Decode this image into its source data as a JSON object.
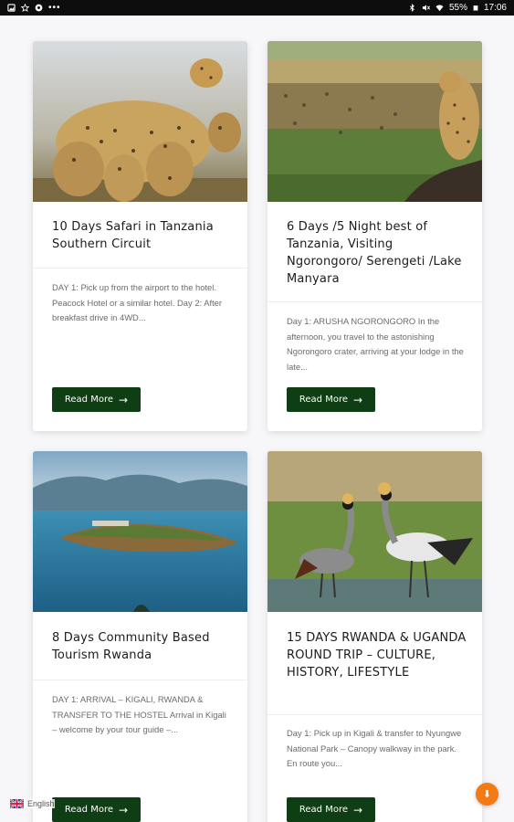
{
  "status_bar": {
    "battery": "55%",
    "time": "17:06",
    "left_icons": [
      "image-icon",
      "star-icon",
      "settings-icon",
      "more-dots-icon"
    ],
    "right_icons": [
      "bluetooth-icon",
      "mute-icon",
      "wifi-icon",
      "battery-icon"
    ]
  },
  "tours": [
    {
      "title": "10 Days Safari in Tanzania Southern Circuit",
      "description": "DAY 1: Pick up from the airport to the hotel. Peacock Hotel or a similar hotel. Day 2: After breakfast drive in 4WD...",
      "cta": "Read More",
      "image": "cheetah family photo"
    },
    {
      "title": "6 Days /5 Night best of Tanzania, Visiting Ngorongoro/ Serengeti /Lake Manyara",
      "description": "Day 1: ARUSHA NGORONGORO In the afternoon, you travel to the astonishing Ngorongoro crater, arriving at your lodge in the late...",
      "cta": "Read More",
      "image": "cheetah on rock overlooking savanna photo"
    },
    {
      "title": "8 Days Community Based Tourism Rwanda",
      "description": "DAY 1: ARRIVAL – KIGALI, RWANDA & TRANSFER TO THE HOSTEL Arrival in Kigali – welcome by your tour guide –...",
      "cta": "Read More",
      "image": "lake island with mountains photo"
    },
    {
      "title": "15 DAYS RWANDA & UGANDA ROUND TRIP – CULTURE, HISTORY, LIFESTYLE",
      "description": "Day 1: Pick up in Kigali & transfer to Nyungwe National Park – Canopy walkway in the park. En route you...",
      "cta": "Read More",
      "image": "grey crowned cranes photo"
    }
  ],
  "language": {
    "label": "English",
    "flag": "uk-flag-icon"
  },
  "scroll_button": {
    "icon": "arrow-down-icon"
  },
  "colors": {
    "button_bg": "#0f3d14",
    "fab_bg": "#f47a16",
    "status_bar_bg": "#0d0d0d"
  }
}
